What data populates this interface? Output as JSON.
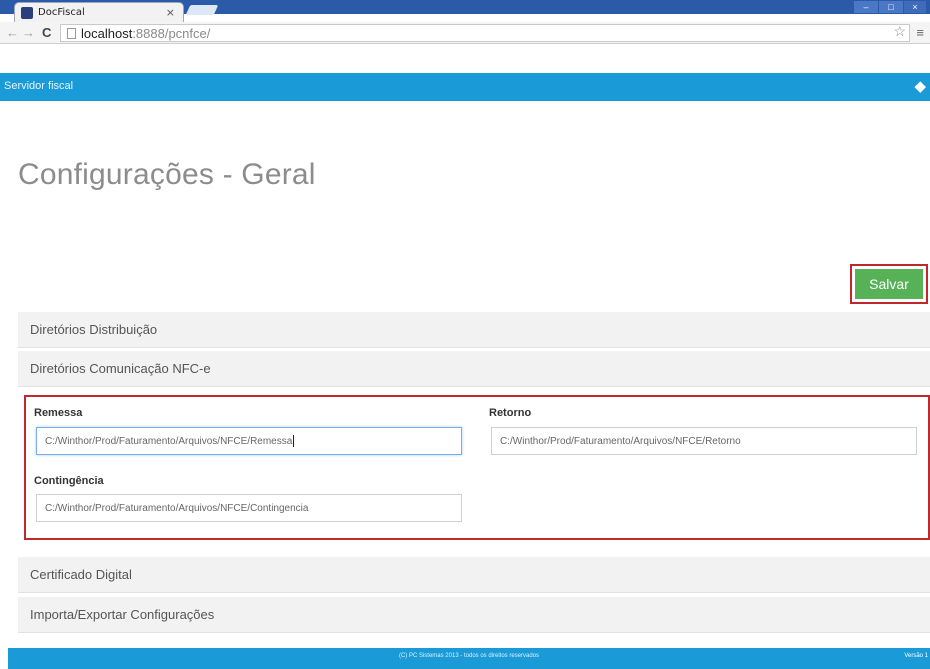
{
  "browser": {
    "tab_title": "DocFiscal",
    "tab_close": "×",
    "url_host": "localhost",
    "url_rest": ":8888/pcnfce/"
  },
  "app": {
    "header_title": "Servidor fiscal",
    "page_title": "Configurações - Geral",
    "save_label": "Salvar"
  },
  "accordion": {
    "distribuicao": "Diretórios Distribuição",
    "comunicacao": "Diretórios Comunicação NFC-e",
    "certificado": "Certificado Digital",
    "importar": "Importa/Exportar Configurações"
  },
  "fields": {
    "remessa_label": "Remessa",
    "remessa_value": "C:/Winthor/Prod/Faturamento/Arquivos/NFCE/Remessa",
    "retorno_label": "Retorno",
    "retorno_value": "C:/Winthor/Prod/Faturamento/Arquivos/NFCE/Retorno",
    "contingencia_label": "Contingência",
    "contingencia_value": "C:/Winthor/Prod/Faturamento/Arquivos/NFCE/Contingencia"
  },
  "footer": {
    "copyright": "(C) PC Sistemas 2013 - todos os direitos reservados",
    "version": "Versão 1"
  },
  "colors": {
    "header_blue": "#1a9bd7",
    "save_green": "#56b157",
    "highlight_red": "#c0282d"
  }
}
